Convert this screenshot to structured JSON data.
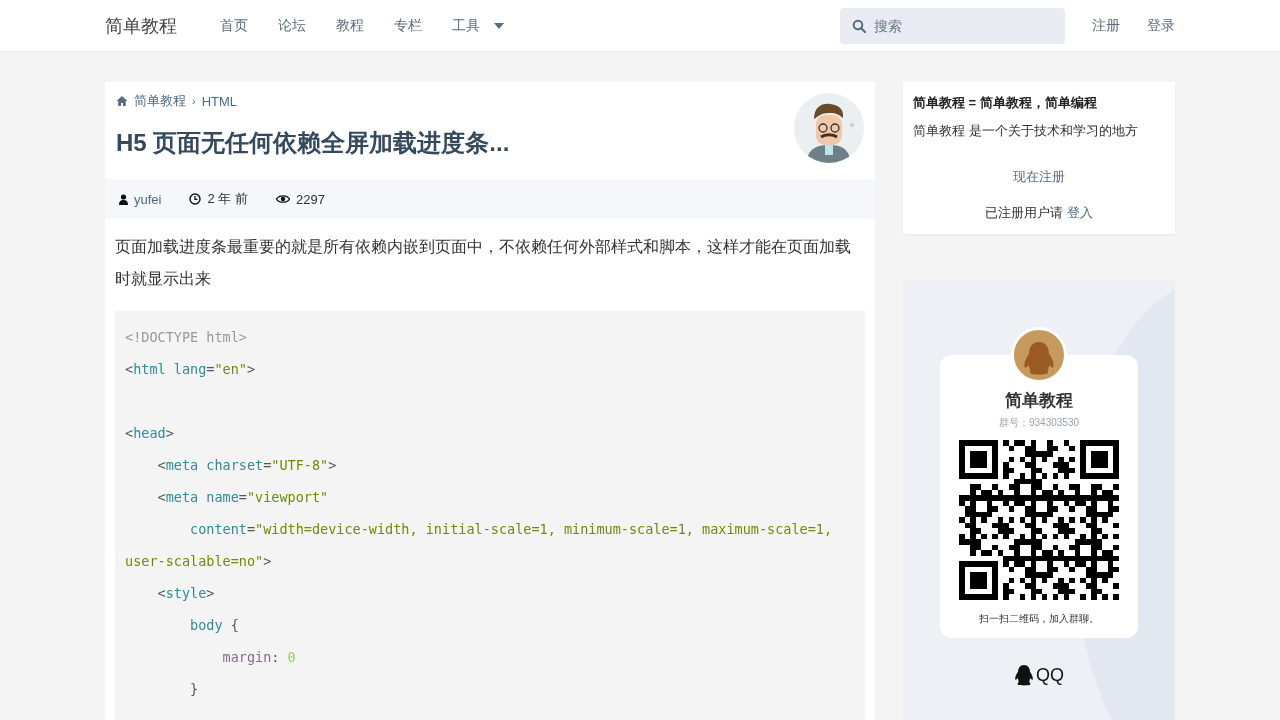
{
  "header": {
    "logo": "简单教程",
    "nav": [
      {
        "label": "首页",
        "selected": false
      },
      {
        "label": "论坛",
        "selected": false
      },
      {
        "label": "教程",
        "selected": false
      },
      {
        "label": "专栏",
        "selected": false
      },
      {
        "label": "工具",
        "selected": false,
        "dropdown": true
      }
    ],
    "search": {
      "placeholder": "搜索"
    },
    "auth": [
      "注册",
      "登录"
    ]
  },
  "article": {
    "breadcrumb": [
      "简单教程",
      "HTML"
    ],
    "breadcrumb_separator": "›",
    "title": "H5 页面无任何依赖全屏加载进度条...",
    "meta": {
      "author": "yufei",
      "time": "2 年 前",
      "views": "2297"
    },
    "intro": "页面加载进度条最重要的就是所有依赖内嵌到页面中，不依赖任何外部样式和脚本，这样才能在页面加载时就显示出来",
    "code": [
      {
        "kind": "code",
        "tokens": [
          {
            "kind": "doctype",
            "t": "<!DOCTYPE html>"
          }
        ]
      },
      {
        "kind": "code",
        "tokens": [
          {
            "kind": "punct",
            "t": "<"
          },
          {
            "kind": "tag",
            "t": "html "
          },
          {
            "kind": "attr",
            "t": "lang"
          },
          {
            "kind": "punct",
            "t": "="
          },
          {
            "kind": "str",
            "t": "\"en\""
          },
          {
            "kind": "punct",
            "t": ">"
          }
        ]
      },
      {
        "kind": "blank"
      },
      {
        "kind": "code",
        "tokens": [
          {
            "kind": "punct",
            "t": "<"
          },
          {
            "kind": "tag",
            "t": "head"
          },
          {
            "kind": "punct",
            "t": ">"
          }
        ]
      },
      {
        "kind": "code",
        "tokens": [
          {
            "kind": "punct",
            "t": "    <"
          },
          {
            "kind": "tag",
            "t": "meta "
          },
          {
            "kind": "attr",
            "t": "charset"
          },
          {
            "kind": "punct",
            "t": "="
          },
          {
            "kind": "str",
            "t": "\"UTF-8\""
          },
          {
            "kind": "punct",
            "t": ">"
          }
        ]
      },
      {
        "kind": "code",
        "tokens": [
          {
            "kind": "punct",
            "t": "    <"
          },
          {
            "kind": "tag",
            "t": "meta "
          },
          {
            "kind": "attr",
            "t": "name"
          },
          {
            "kind": "punct",
            "t": "="
          },
          {
            "kind": "str",
            "t": "\"viewport\""
          }
        ]
      },
      {
        "kind": "code",
        "tokens": [
          {
            "kind": "attr",
            "t": "        content"
          },
          {
            "kind": "punct",
            "t": "="
          },
          {
            "kind": "str",
            "t": "\"width=device-width, initial-scale=1, minimum-scale=1, maximum-scale=1,"
          }
        ]
      },
      {
        "kind": "code",
        "tokens": [
          {
            "kind": "str",
            "t": "user-scalable=no\""
          },
          {
            "kind": "punct",
            "t": ">"
          }
        ]
      },
      {
        "kind": "code",
        "tokens": [
          {
            "kind": "punct",
            "t": "    <"
          },
          {
            "kind": "tag",
            "t": "style"
          },
          {
            "kind": "punct",
            "t": ">"
          }
        ]
      },
      {
        "kind": "code",
        "tokens": [
          {
            "kind": "tag",
            "t": "        body "
          },
          {
            "kind": "punct",
            "t": "{"
          }
        ]
      },
      {
        "kind": "code",
        "tokens": [
          {
            "kind": "prop",
            "t": "            margin"
          },
          {
            "kind": "punct",
            "t": ": "
          },
          {
            "kind": "num",
            "t": "0"
          }
        ]
      },
      {
        "kind": "code",
        "tokens": [
          {
            "kind": "punct",
            "t": "        }"
          }
        ]
      }
    ]
  },
  "sidebar": {
    "heading": "简单教程 = 简单教程，简单编程",
    "tagline": "简单教程 是一个关于技术和学习的地方",
    "register": "现在注册",
    "login_prompt": "已注册用户请",
    "login_link": "登入",
    "qq_card": {
      "name": "简单教程",
      "group": "群号：934303530",
      "caption": "扫一扫二维码，加入群聊。",
      "brand": "QQ"
    }
  }
}
